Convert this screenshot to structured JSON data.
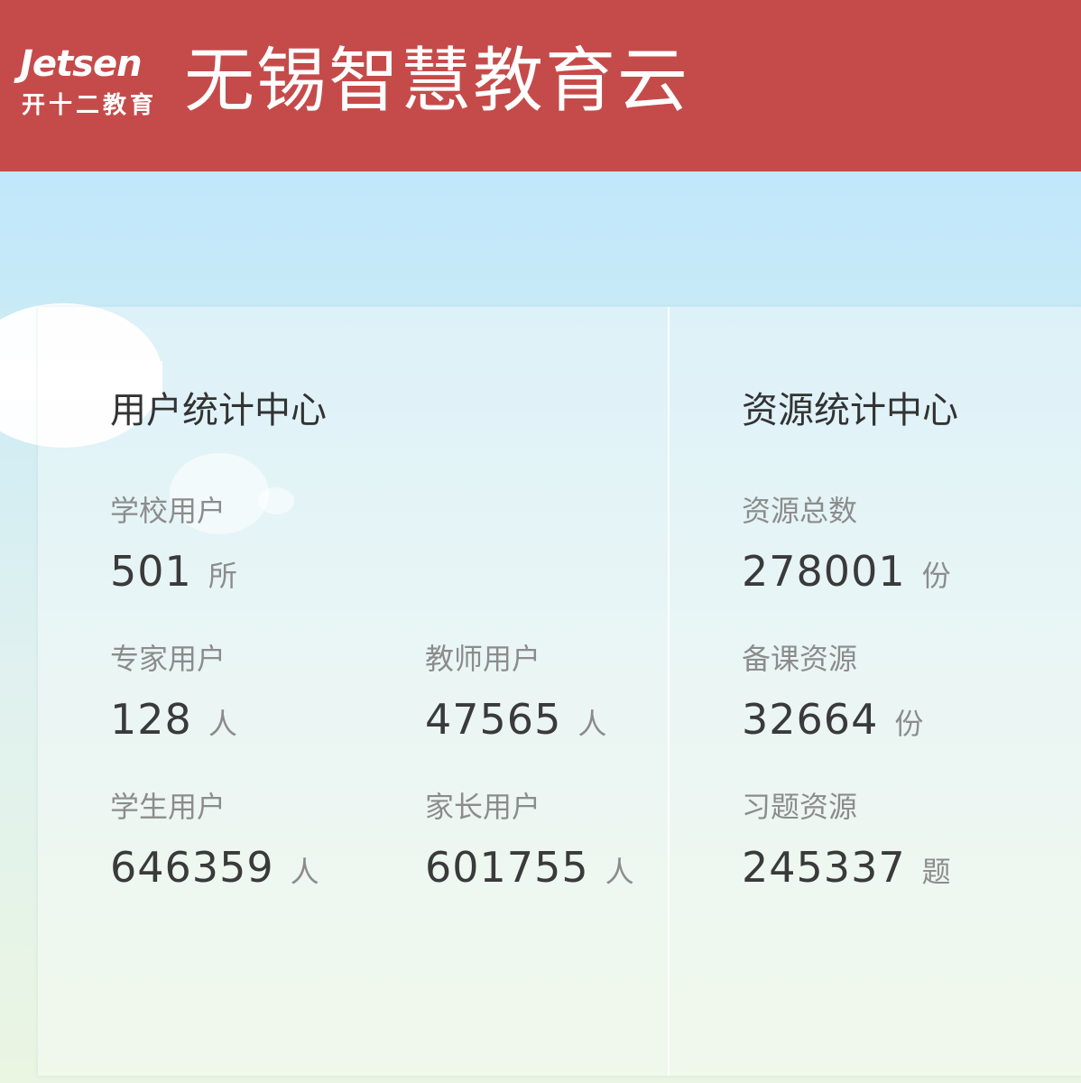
{
  "header": {
    "logo_brand": "Jetsen",
    "logo_sub": "开十二教育",
    "title": "无锡智慧教育云",
    "background_color": "#c54b4a"
  },
  "user_stats": {
    "title": "用户统计中心",
    "items": [
      {
        "label": "学校用户",
        "value": "501",
        "unit": "所"
      },
      {
        "label": "专家用户",
        "value": "128",
        "unit": "人"
      },
      {
        "label": "教师用户",
        "value": "47565",
        "unit": "人"
      },
      {
        "label": "学生用户",
        "value": "646359",
        "unit": "人"
      },
      {
        "label": "家长用户",
        "value": "601755",
        "unit": "人"
      }
    ]
  },
  "resource_stats": {
    "title": "资源统计中心",
    "items": [
      {
        "label": "资源总数",
        "value": "278001",
        "unit": "份"
      },
      {
        "label": "备课资源",
        "value": "32664",
        "unit": "份"
      },
      {
        "label": "习题资源",
        "value": "245337",
        "unit": "题"
      }
    ]
  }
}
